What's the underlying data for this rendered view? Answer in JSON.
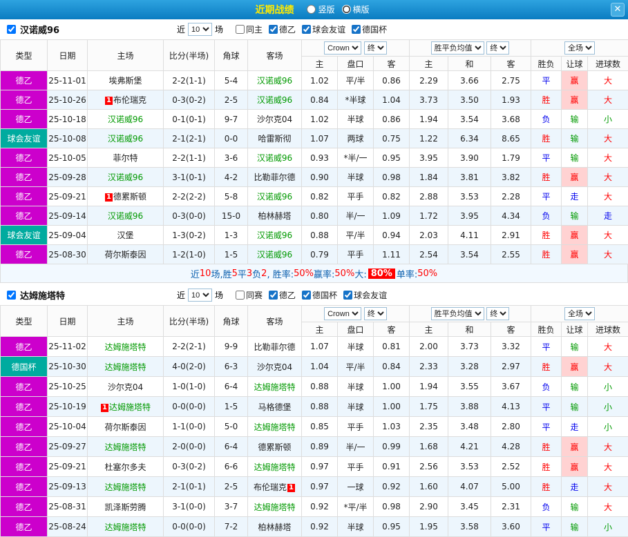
{
  "titlebar": {
    "title": "近期战绩",
    "layout_options": [
      {
        "label": "竖版",
        "selected": false
      },
      {
        "label": "横版",
        "selected": true
      }
    ],
    "close_label": "✕"
  },
  "table_headers": {
    "static": [
      "类型",
      "日期",
      "主场",
      "比分(半场)",
      "角球",
      "客场"
    ],
    "sub": [
      "主",
      "盘口",
      "客",
      "主",
      "和",
      "客",
      "胜负",
      "让球",
      "进球数"
    ],
    "odds_source": "Crown",
    "final_label": "终",
    "avg_label": "胜平负均值",
    "final_label2": "终",
    "scope_label": "全场"
  },
  "league_colors": {
    "德乙": "#cc00cc",
    "球会友谊": "#00ab9f",
    "德国杯": "#00ab9f"
  },
  "result_colors": {
    "胜": "#ff0000",
    "平": "#0000ee",
    "负": "#0000ee"
  },
  "handicap_result_colors": {
    "赢": "#ff0000",
    "输": "#009900",
    "走": "#0000ee"
  },
  "handicap_win_bg": "#ffd2d2",
  "goal_colors": {
    "大": "#ff0000",
    "小": "#009900",
    "走": "#0000ee"
  },
  "sections": [
    {
      "team": "汉诺威96",
      "team_checked": "checked",
      "near_label": "近",
      "count": "10",
      "games_label": "场",
      "filters": [
        {
          "label": "同主",
          "checked": false
        },
        {
          "label": "德乙",
          "checked": true
        },
        {
          "label": "球会友谊",
          "checked": true
        },
        {
          "label": "德国杯",
          "checked": true
        }
      ],
      "rows": [
        {
          "league": "德乙",
          "date": "25-11-01",
          "home": "埃弗斯堡",
          "home_focus": false,
          "home_badge": "",
          "score": "2-2(1-1)",
          "corner": "5-4",
          "away": "汉诺威96",
          "away_focus": true,
          "away_badge": "",
          "ah_home": "1.02",
          "ah_line": "平/半",
          "ah_away": "0.86",
          "eu_home": "2.29",
          "eu_draw": "3.66",
          "eu_away": "2.75",
          "result": "平",
          "handicap_result": "赢",
          "goals": "大"
        },
        {
          "league": "德乙",
          "date": "25-10-26",
          "home": "布伦瑞克",
          "home_focus": false,
          "home_badge": "1",
          "score": "0-3(0-2)",
          "corner": "2-5",
          "away": "汉诺威96",
          "away_focus": true,
          "away_badge": "",
          "ah_home": "0.84",
          "ah_line": "*半球",
          "ah_away": "1.04",
          "eu_home": "3.73",
          "eu_draw": "3.50",
          "eu_away": "1.93",
          "result": "胜",
          "handicap_result": "赢",
          "goals": "大"
        },
        {
          "league": "德乙",
          "date": "25-10-18",
          "home": "汉诺威96",
          "home_focus": true,
          "home_badge": "",
          "score": "0-1(0-1)",
          "corner": "9-7",
          "away": "沙尔克04",
          "away_focus": false,
          "away_badge": "",
          "ah_home": "1.02",
          "ah_line": "半球",
          "ah_away": "0.86",
          "eu_home": "1.94",
          "eu_draw": "3.54",
          "eu_away": "3.68",
          "result": "负",
          "handicap_result": "输",
          "goals": "小"
        },
        {
          "league": "球会友谊",
          "date": "25-10-08",
          "home": "汉诺威96",
          "home_focus": true,
          "home_badge": "",
          "score": "2-1(2-1)",
          "corner": "0-0",
          "away": "哈雷斯彻",
          "away_focus": false,
          "away_badge": "",
          "ah_home": "1.07",
          "ah_line": "两球",
          "ah_away": "0.75",
          "eu_home": "1.22",
          "eu_draw": "6.34",
          "eu_away": "8.65",
          "result": "胜",
          "handicap_result": "输",
          "goals": "大"
        },
        {
          "league": "德乙",
          "date": "25-10-05",
          "home": "菲尔特",
          "home_focus": false,
          "home_badge": "",
          "score": "2-2(1-1)",
          "corner": "3-6",
          "away": "汉诺威96",
          "away_focus": true,
          "away_badge": "",
          "ah_home": "0.93",
          "ah_line": "*半/一",
          "ah_away": "0.95",
          "eu_home": "3.95",
          "eu_draw": "3.90",
          "eu_away": "1.79",
          "result": "平",
          "handicap_result": "输",
          "goals": "大"
        },
        {
          "league": "德乙",
          "date": "25-09-28",
          "home": "汉诺威96",
          "home_focus": true,
          "home_badge": "",
          "score": "3-1(0-1)",
          "corner": "4-2",
          "away": "比勒菲尔德",
          "away_focus": false,
          "away_badge": "",
          "ah_home": "0.90",
          "ah_line": "半球",
          "ah_away": "0.98",
          "eu_home": "1.84",
          "eu_draw": "3.81",
          "eu_away": "3.82",
          "result": "胜",
          "handicap_result": "赢",
          "goals": "大"
        },
        {
          "league": "德乙",
          "date": "25-09-21",
          "home": "德累斯顿",
          "home_focus": false,
          "home_badge": "1",
          "score": "2-2(2-2)",
          "corner": "5-8",
          "away": "汉诺威96",
          "away_focus": true,
          "away_badge": "",
          "ah_home": "0.82",
          "ah_line": "平手",
          "ah_away": "0.82",
          "eu_home": "2.88",
          "eu_draw": "3.53",
          "eu_away": "2.28",
          "result": "平",
          "handicap_result": "走",
          "goals": "大"
        },
        {
          "league": "德乙",
          "date": "25-09-14",
          "home": "汉诺威96",
          "home_focus": true,
          "home_badge": "",
          "score": "0-3(0-0)",
          "corner": "15-0",
          "away": "柏林赫塔",
          "away_focus": false,
          "away_badge": "",
          "ah_home": "0.80",
          "ah_line": "半/一",
          "ah_away": "1.09",
          "eu_home": "1.72",
          "eu_draw": "3.95",
          "eu_away": "4.34",
          "result": "负",
          "handicap_result": "输",
          "goals": "走"
        },
        {
          "league": "球会友谊",
          "date": "25-09-04",
          "home": "汉堡",
          "home_focus": false,
          "home_badge": "",
          "score": "1-3(0-2)",
          "corner": "1-3",
          "away": "汉诺威96",
          "away_focus": true,
          "away_badge": "",
          "ah_home": "0.88",
          "ah_line": "平/半",
          "ah_away": "0.94",
          "eu_home": "2.03",
          "eu_draw": "4.11",
          "eu_away": "2.91",
          "result": "胜",
          "handicap_result": "赢",
          "goals": "大"
        },
        {
          "league": "德乙",
          "date": "25-08-30",
          "home": "荷尔斯泰因",
          "home_focus": false,
          "home_badge": "",
          "score": "1-2(1-0)",
          "corner": "1-5",
          "away": "汉诺威96",
          "away_focus": true,
          "away_badge": "",
          "ah_home": "0.79",
          "ah_line": "平手",
          "ah_away": "1.11",
          "eu_home": "2.54",
          "eu_draw": "3.54",
          "eu_away": "2.55",
          "result": "胜",
          "handicap_result": "赢",
          "goals": "大"
        }
      ],
      "summary": [
        {
          "t": "近",
          "c": "blue"
        },
        {
          "t": "10",
          "c": "red"
        },
        {
          "t": "场,胜",
          "c": "blue"
        },
        {
          "t": "5",
          "c": "red"
        },
        {
          "t": "平",
          "c": "blue"
        },
        {
          "t": "3",
          "c": "red"
        },
        {
          "t": "负",
          "c": "blue"
        },
        {
          "t": "2",
          "c": "red"
        },
        {
          "t": ", 胜率:",
          "c": "blue"
        },
        {
          "t": "50%",
          "c": "red"
        },
        {
          "t": " 赢率:",
          "c": "blue"
        },
        {
          "t": "50%",
          "c": "red"
        },
        {
          "t": " 大:",
          "c": "blue"
        },
        {
          "t": "80%",
          "c": "redbg"
        },
        {
          "t": " 单率:",
          "c": "blue"
        },
        {
          "t": "50%",
          "c": "red"
        }
      ]
    },
    {
      "team": "达姆施塔特",
      "team_checked": "checked",
      "near_label": "近",
      "count": "10",
      "games_label": "场",
      "filters": [
        {
          "label": "同赛",
          "checked": false
        },
        {
          "label": "德乙",
          "checked": true
        },
        {
          "label": "德国杯",
          "checked": true
        },
        {
          "label": "球会友谊",
          "checked": true
        }
      ],
      "rows": [
        {
          "league": "德乙",
          "date": "25-11-02",
          "home": "达姆施塔特",
          "home_focus": true,
          "home_badge": "",
          "score": "2-2(2-1)",
          "corner": "9-9",
          "away": "比勒菲尔德",
          "away_focus": false,
          "away_badge": "",
          "ah_home": "1.07",
          "ah_line": "半球",
          "ah_away": "0.81",
          "eu_home": "2.00",
          "eu_draw": "3.73",
          "eu_away": "3.32",
          "result": "平",
          "handicap_result": "输",
          "goals": "大"
        },
        {
          "league": "德国杯",
          "date": "25-10-30",
          "home": "达姆施塔特",
          "home_focus": true,
          "home_badge": "",
          "score": "4-0(2-0)",
          "corner": "6-3",
          "away": "沙尔克04",
          "away_focus": false,
          "away_badge": "",
          "ah_home": "1.04",
          "ah_line": "平/半",
          "ah_away": "0.84",
          "eu_home": "2.33",
          "eu_draw": "3.28",
          "eu_away": "2.97",
          "result": "胜",
          "handicap_result": "赢",
          "goals": "大"
        },
        {
          "league": "德乙",
          "date": "25-10-25",
          "home": "沙尔克04",
          "home_focus": false,
          "home_badge": "",
          "score": "1-0(1-0)",
          "corner": "6-4",
          "away": "达姆施塔特",
          "away_focus": true,
          "away_badge": "",
          "ah_home": "0.88",
          "ah_line": "半球",
          "ah_away": "1.00",
          "eu_home": "1.94",
          "eu_draw": "3.55",
          "eu_away": "3.67",
          "result": "负",
          "handicap_result": "输",
          "goals": "小"
        },
        {
          "league": "德乙",
          "date": "25-10-19",
          "home": "达姆施塔特",
          "home_focus": true,
          "home_badge": "1",
          "score": "0-0(0-0)",
          "corner": "1-5",
          "away": "马格德堡",
          "away_focus": false,
          "away_badge": "",
          "ah_home": "0.88",
          "ah_line": "半球",
          "ah_away": "1.00",
          "eu_home": "1.75",
          "eu_draw": "3.88",
          "eu_away": "4.13",
          "result": "平",
          "handicap_result": "输",
          "goals": "小"
        },
        {
          "league": "德乙",
          "date": "25-10-04",
          "home": "荷尔斯泰因",
          "home_focus": false,
          "home_badge": "",
          "score": "1-1(0-0)",
          "corner": "5-0",
          "away": "达姆施塔特",
          "away_focus": true,
          "away_badge": "",
          "ah_home": "0.85",
          "ah_line": "平手",
          "ah_away": "1.03",
          "eu_home": "2.35",
          "eu_draw": "3.48",
          "eu_away": "2.80",
          "result": "平",
          "handicap_result": "走",
          "goals": "小"
        },
        {
          "league": "德乙",
          "date": "25-09-27",
          "home": "达姆施塔特",
          "home_focus": true,
          "home_badge": "",
          "score": "2-0(0-0)",
          "corner": "6-4",
          "away": "德累斯顿",
          "away_focus": false,
          "away_badge": "",
          "ah_home": "0.89",
          "ah_line": "半/一",
          "ah_away": "0.99",
          "eu_home": "1.68",
          "eu_draw": "4.21",
          "eu_away": "4.28",
          "result": "胜",
          "handicap_result": "赢",
          "goals": "大"
        },
        {
          "league": "德乙",
          "date": "25-09-21",
          "home": "杜塞尔多夫",
          "home_focus": false,
          "home_badge": "",
          "score": "0-3(0-2)",
          "corner": "6-6",
          "away": "达姆施塔特",
          "away_focus": true,
          "away_badge": "",
          "ah_home": "0.97",
          "ah_line": "平手",
          "ah_away": "0.91",
          "eu_home": "2.56",
          "eu_draw": "3.53",
          "eu_away": "2.52",
          "result": "胜",
          "handicap_result": "赢",
          "goals": "大"
        },
        {
          "league": "德乙",
          "date": "25-09-13",
          "home": "达姆施塔特",
          "home_focus": true,
          "home_badge": "",
          "score": "2-1(0-1)",
          "corner": "2-5",
          "away": "布伦瑞克",
          "away_focus": false,
          "away_badge": "1",
          "away_badge_after": true,
          "ah_home": "0.97",
          "ah_line": "一球",
          "ah_away": "0.92",
          "eu_home": "1.60",
          "eu_draw": "4.07",
          "eu_away": "5.00",
          "result": "胜",
          "handicap_result": "走",
          "goals": "大"
        },
        {
          "league": "德乙",
          "date": "25-08-31",
          "home": "凯泽斯劳腾",
          "home_focus": false,
          "home_badge": "",
          "score": "3-1(0-0)",
          "corner": "3-7",
          "away": "达姆施塔特",
          "away_focus": true,
          "away_badge": "",
          "ah_home": "0.92",
          "ah_line": "*平/半",
          "ah_away": "0.98",
          "eu_home": "2.90",
          "eu_draw": "3.45",
          "eu_away": "2.31",
          "result": "负",
          "handicap_result": "输",
          "goals": "大"
        },
        {
          "league": "德乙",
          "date": "25-08-24",
          "home": "达姆施塔特",
          "home_focus": true,
          "home_badge": "",
          "score": "0-0(0-0)",
          "corner": "7-2",
          "away": "柏林赫塔",
          "away_focus": false,
          "away_badge": "",
          "ah_home": "0.92",
          "ah_line": "半球",
          "ah_away": "0.95",
          "eu_home": "1.95",
          "eu_draw": "3.58",
          "eu_away": "3.60",
          "result": "平",
          "handicap_result": "输",
          "goals": "小"
        }
      ]
    }
  ]
}
